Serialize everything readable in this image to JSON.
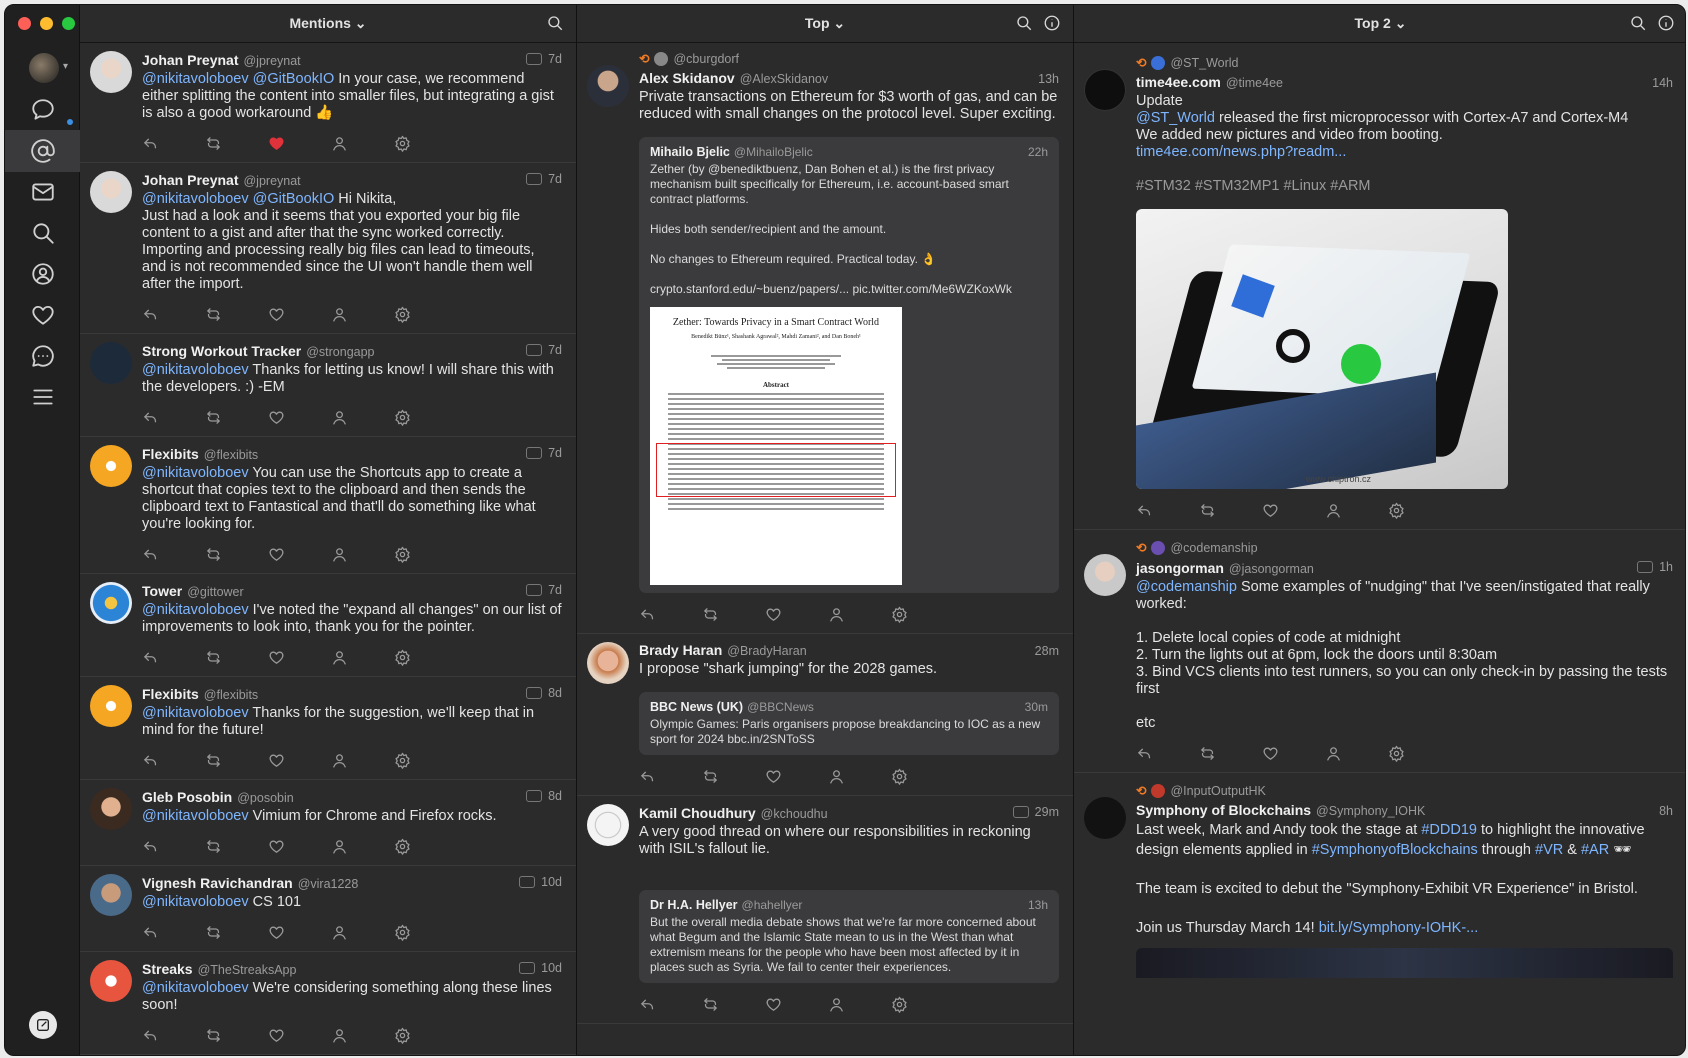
{
  "sidebar": {
    "nav": [
      {
        "name": "messages-icon"
      },
      {
        "name": "mentions-icon"
      },
      {
        "name": "mail-icon"
      },
      {
        "name": "search-icon"
      },
      {
        "name": "profile-icon"
      },
      {
        "name": "likes-icon"
      },
      {
        "name": "chat-icon"
      },
      {
        "name": "menu-icon"
      }
    ]
  },
  "columns": {
    "mentions": {
      "title": "Mentions ⌄"
    },
    "top": {
      "title": "Top ⌄"
    },
    "top2": {
      "title": "Top 2 ⌄"
    }
  },
  "mentions_tweets": [
    {
      "name": "Johan Preynat",
      "handle": "@jpreynat",
      "time": "7d",
      "mention": "@nikitavoloboev @GitBookIO",
      "text": " In your case, we recommend either splitting the content into smaller files, but integrating a gist is also a good workaround 👍",
      "liked": true
    },
    {
      "name": "Johan Preynat",
      "handle": "@jpreynat",
      "time": "7d",
      "mention": "@nikitavoloboev @GitBookIO",
      "text": " Hi Nikita,\nJust had a look and it seems that you exported your big file content to a gist and after that the sync worked correctly.\nImporting and processing really big files can lead to timeouts, and is not recommended since the UI won't handle them well after the import."
    },
    {
      "name": "Strong Workout Tracker",
      "handle": "@strongapp",
      "time": "7d",
      "mention": "@nikitavoloboev",
      "text": " Thanks for letting us know! I will share this with the developers. :) -EM"
    },
    {
      "name": "Flexibits",
      "handle": "@flexibits",
      "time": "7d",
      "mention": "@nikitavoloboev",
      "text": " You can use the Shortcuts app to create a shortcut that copies text to the clipboard and then sends the clipboard text to Fantastical and that'll do something like what you're looking for."
    },
    {
      "name": "Tower",
      "handle": "@gittower",
      "time": "7d",
      "mention": "@nikitavoloboev",
      "text": " I've noted the \"expand all changes\" on our list of improvements to look into, thank you for the pointer."
    },
    {
      "name": "Flexibits",
      "handle": "@flexibits",
      "time": "8d",
      "mention": "@nikitavoloboev",
      "text": " Thanks for the suggestion, we'll keep that in mind for the future!"
    },
    {
      "name": "Gleb Posobin",
      "handle": "@posobin",
      "time": "8d",
      "mention": "@nikitavoloboev",
      "text": " Vimium for Chrome and Firefox rocks."
    },
    {
      "name": "Vignesh Ravichandran",
      "handle": "@vira1228",
      "time": "10d",
      "mention": "@nikitavoloboev",
      "text": " CS 101"
    },
    {
      "name": "Streaks",
      "handle": "@TheStreaksApp",
      "time": "10d",
      "mention": "@nikitavoloboev",
      "text": " We're considering something along these lines soon!"
    }
  ],
  "top": {
    "t1": {
      "rt": "@cburgdorf",
      "name": "Alex Skidanov",
      "handle": "@AlexSkidanov",
      "time": "13h",
      "text": "Private transactions on Ethereum for $3 worth of gas, and can be reduced with small changes on the protocol level. Super exciting.",
      "quote": {
        "name": "Mihailo Bjelic",
        "handle": "@MihailoBjelic",
        "time": "22h",
        "text": "Zether (by @benediktbuenz, Dan Bohen et al.) is the first privacy mechanism built specifically for Ethereum, i.e. account-based smart contract platforms.\n\nHides both sender/recipient and the amount.\n\nNo changes to Ethereum required. Practical today. 👌\n\ncrypto.stanford.edu/~buenz/papers/... pic.twitter.com/Me6WZKoxWk"
      },
      "paper": {
        "title": "Zether: Towards Privacy in a Smart Contract World",
        "authors": "Benedikt Bünz¹, Shashank Agrawal², Mahdi Zamani², and Dan Boneh¹",
        "abstract": "Abstract"
      }
    },
    "t2": {
      "name": "Brady Haran",
      "handle": "@BradyHaran",
      "time": "28m",
      "text": "I propose \"shark jumping\" for the 2028 games.",
      "quote": {
        "name": "BBC News (UK)",
        "handle": "@BBCNews",
        "time": "30m",
        "text": "Olympic Games: Paris organisers propose breakdancing to IOC as a new sport for 2024 bbc.in/2SNToSS"
      }
    },
    "t3": {
      "name": "Kamil Choudhury",
      "handle": "@kchoudhu",
      "time": "29m",
      "text": "A very good thread on where our responsibilities in reckoning with ISIL's fallout lie.",
      "quote": {
        "name": "Dr H.A. Hellyer",
        "handle": "@hahellyer",
        "time": "13h",
        "text": "But the overall media debate shows that we're far more concerned about what Begum and the Islamic State mean to us in the West than what extremism means for the people who have been most affected by it in places such as Syria. We fail to center their experiences."
      }
    }
  },
  "top2": {
    "t1": {
      "rt": "@ST_World",
      "name": "time4ee.com",
      "handle": "@time4ee",
      "time": "14h",
      "text1": "Update",
      "mention": "@ST_World",
      "text2": " released the first microprocessor with Cortex-A7 and Cortex-M4\nWe added new pictures and video from booting.",
      "link": "time4ee.com/news.php?readm...",
      "tags": "#STM32 #STM32MP1 #Linux #ARM",
      "watermark": "www.chiptron.cz"
    },
    "t2": {
      "rt": "@codemanship",
      "name": "jasongorman",
      "handle": "@jasongorman",
      "time": "1h",
      "mention": "@codemanship",
      "text": " Some examples of \"nudging\" that I've seen/instigated that really worked:\n\n1. Delete local copies of code at midnight\n2. Turn the lights out at 6pm, lock the doors until 8:30am\n3. Bind VCS clients into test runners, so you can only check-in by passing the tests first\n\netc"
    },
    "t3": {
      "rt": "@InputOutputHK",
      "name": "Symphony of Blockchains",
      "handle": "@Symphony_IOHK",
      "time": "8h",
      "text1": "Last week, Mark and Andy took the stage at ",
      "tag1": "#DDD19",
      "text2": " to highlight the innovative design elements applied in ",
      "tag2": "#SymphonyofBlockchains",
      "text3": " through ",
      "tag3": "#VR",
      "text4": " & ",
      "tag4": "#AR",
      "text5": " 🕶\n\nThe team is excited to debut the \"Symphony-Exhibit VR Experience\" in Bristol.\n\nJoin us Thursday March 14! ",
      "link": "bit.ly/Symphony-IOHK-..."
    }
  },
  "colors": {
    "accent": "#7eb6ff",
    "like": "#e0323a",
    "retweet_icon": "#f07b24",
    "background": "#2b2b2c"
  }
}
